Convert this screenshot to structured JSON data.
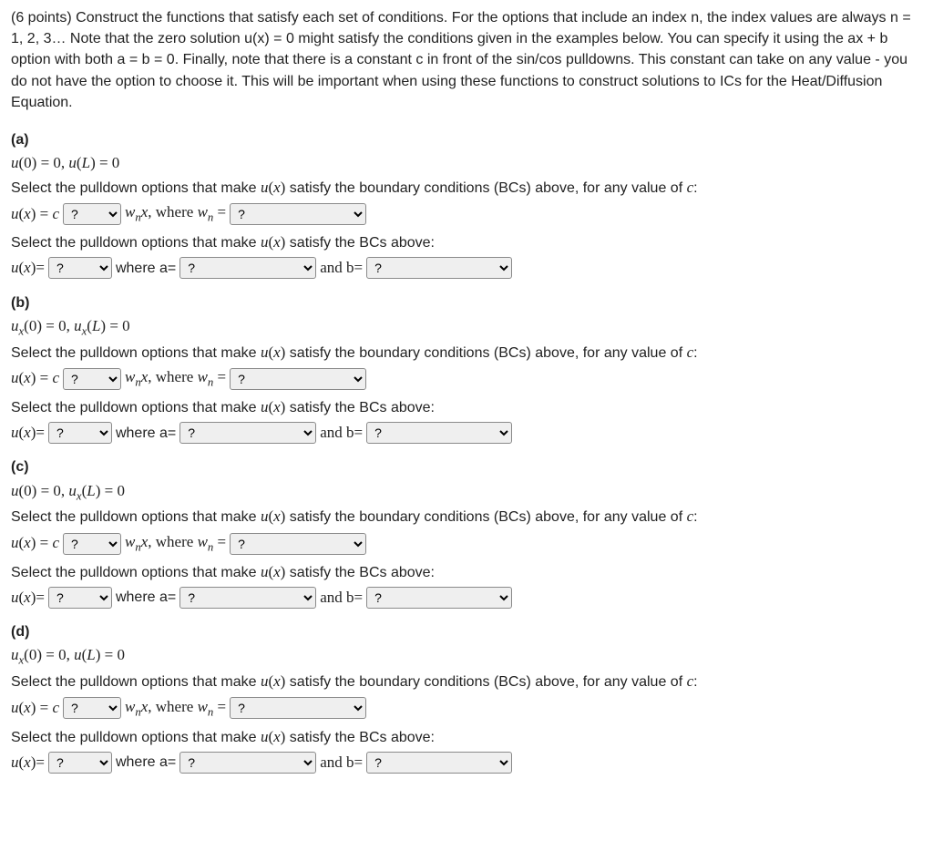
{
  "intro": "(6 points) Construct the functions that satisfy each set of conditions. For the options that include an index n, the index values are always n = 1, 2, 3… Note that the zero solution u(x) = 0 might satisfy the conditions given in the examples below. You can specify it using the ax + b option with both a = b = 0. Finally, note that there is a constant c in front of the sin/cos pulldowns. This constant can take on any value - you do not have the option to choose it. This will be important when using these functions to construct solutions to ICs for the Heat/Diffusion Equation.",
  "common": {
    "prompt1_prefix": "Select the pulldown options that make ",
    "prompt1_mid": " satisfy the boundary conditions (BCs) above, for any value of ",
    "prompt1_suffix": ":",
    "prompt2_prefix": "Select the pulldown options that make ",
    "prompt2_suffix": " satisfy the BCs above:",
    "ux_eq_c": "u(x) = c",
    "wnx_where": "wₙx, where wₙ =",
    "ux_eq": "u(x)=",
    "where_a": "where a=",
    "and_b": "and b=",
    "ux": "u(x)",
    "c": "c",
    "placeholder": "?"
  },
  "parts": [
    {
      "label": "(a)",
      "bc": "u(0) = 0, u(L) = 0"
    },
    {
      "label": "(b)",
      "bc": "uₓ(0) = 0, uₓ(L) = 0"
    },
    {
      "label": "(c)",
      "bc": "u(0) = 0, uₓ(L) = 0"
    },
    {
      "label": "(d)",
      "bc": "uₓ(0) = 0, u(L) = 0"
    }
  ]
}
